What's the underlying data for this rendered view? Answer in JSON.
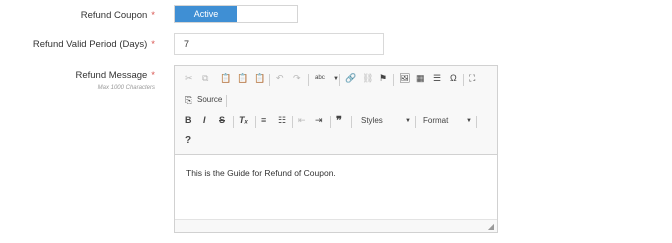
{
  "form": {
    "refund_coupon": {
      "label": "Refund Coupon",
      "required_mark": "*",
      "toggle_active_label": "Active"
    },
    "refund_valid_period": {
      "label": "Refund Valid Period (Days)",
      "required_mark": "*",
      "value": "7"
    },
    "refund_message": {
      "label": "Refund Message",
      "required_mark": "*",
      "hint": "Max 1000 Characters",
      "content": "This is the Guide for Refund of Coupon."
    }
  },
  "toolbar": {
    "source_label": "Source",
    "styles_label": "Styles",
    "format_label": "Format",
    "help_label": "?"
  },
  "colors": {
    "accent": "#3f8fd4",
    "required": "#d9534f"
  }
}
